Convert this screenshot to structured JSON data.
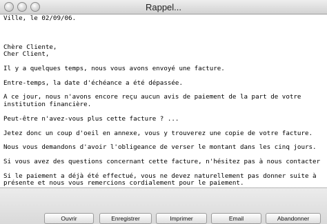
{
  "window": {
    "title": "Rappel..."
  },
  "letter": {
    "text": "Ville, le 02/09/06.\n\n\n\nChère Cliente,\nCher Client,\n\nIl y a quelques temps, nous vous avons envoyé une facture.\n\nEntre-temps, la date d'échéance a été dépassée.\n\nA ce jour, nous n'avons encore reçu aucun avis de paiement de la part de votre\ninstitution financière.\n\nPeut-être n'avez-vous plus cette facture ? ...\n\nJetez donc un coup d'oeil en annexe, vous y trouverez une copie de votre facture.\n\nNous vous demandons d'avoir l'obligeance de verser le montant dans les cinq jours.\n\nSi vous avez des questions concernant cette facture, n'hésitez pas à nous contacter\n\nSi le paiement a déjà été effectué, vous ne devez naturellement pas donner suite à\nprésente et nous vous remercions cordialement pour le paiement.\n\n\nVeuillez agréer, Chère Cliente, Cher Client, l'expression de nos salutations distin"
  },
  "buttons": {
    "open": "Ouvrir",
    "save": "Enregistrer",
    "print": "Imprimer",
    "email": "Email",
    "abandon": "Abandonner"
  }
}
